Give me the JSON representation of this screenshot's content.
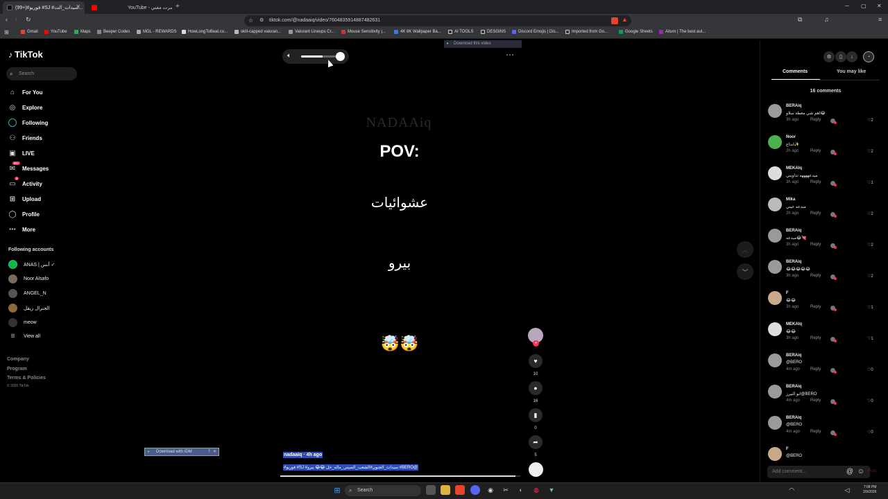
{
  "browser": {
    "tabs": [
      {
        "label": "(99+)#فوريو #SJ #سيدات_الت...",
        "favicon_color": "#000000",
        "active": true
      },
      {
        "label": "YouTube - صرت مغني",
        "favicon_color": "#ff0000",
        "active": false
      }
    ],
    "url": "tiktok.com/@nadaaiq/video/7604835914887482631",
    "bookmarks": [
      "Gmail",
      "YouTube",
      "Maps",
      "Beeper Codes",
      "MGL - REWARDS",
      "HowLongToBeat.co...",
      "skill-capped valoran...",
      "Valorant Lineups Cr...",
      "Mouse Sensitivity |...",
      "4K 8K Wallpaper Ba...",
      "AI TOOLS",
      "DESGINS",
      "Discord Emojis | Dis...",
      "Imported from Go...",
      "Google Sheets",
      "Aitum | The best aut..."
    ]
  },
  "sidebar": {
    "logo": "TikTok",
    "search_placeholder": "Search",
    "nav": [
      {
        "label": "For You",
        "icon": "home-icon"
      },
      {
        "label": "Explore",
        "icon": "compass-icon"
      },
      {
        "label": "Following",
        "icon": "following-icon"
      },
      {
        "label": "Friends",
        "icon": "friends-icon"
      },
      {
        "label": "LIVE",
        "icon": "live-icon"
      },
      {
        "label": "Messages",
        "icon": "messages-icon",
        "badge": "99+"
      },
      {
        "label": "Activity",
        "icon": "activity-icon",
        "badge": "3"
      },
      {
        "label": "Upload",
        "icon": "upload-icon"
      },
      {
        "label": "Profile",
        "icon": "profile-icon"
      },
      {
        "label": "More",
        "icon": "more-icon"
      }
    ],
    "following_title": "Following accounts",
    "following": [
      "ANAS | أنس ✓",
      "Noor Alsafo",
      "ANGEL_N",
      "الجنرال زيقل",
      "meow"
    ],
    "view_all": "View all",
    "footer": [
      "Company",
      "Program",
      "Terms & Policies"
    ],
    "copyright": "© 2026 TikTok"
  },
  "video": {
    "watermark": "NADAAiq",
    "pov": "POV:",
    "line1": "عشوائيات",
    "line2": "بيرو",
    "emoji": "🤯🤯",
    "volume": 0.55,
    "progress": 0.98,
    "download_video": "Download this video",
    "download_idm": "Download with IDM",
    "caption_user": "nadaaiq · 4h ago",
    "caption_tags": "#فوريو #SJ #سيدات_الجنون#الشعب_الصيني_ماله_حل 😂😂 بيرو #BERO@"
  },
  "actions": {
    "likes": "10",
    "comments": "16",
    "saves": "0",
    "shares": "5"
  },
  "panel": {
    "tabs": [
      "Comments",
      "You may like"
    ],
    "count_label": "16 comments",
    "reply_label": "Reply",
    "add_comment_placeholder": "Add comment...",
    "post_label": "Post",
    "comments": [
      {
        "name": "BERAiq",
        "text": "اهم شي معطة سلاو😂",
        "time": "3h ago",
        "likes": "2",
        "avatar_color": "#9a9a9a"
      },
      {
        "name": "Noor",
        "text": "ابداع✨",
        "time": "2h ago",
        "likes": "2",
        "avatar_color": "#4caf50"
      },
      {
        "name": "MEKAIq",
        "text": "مبدعههههه تداويني",
        "time": "3h ago",
        "likes": "1",
        "avatar_color": "#dddddd"
      },
      {
        "name": "Mika",
        "text": "مبدعه عيني",
        "time": "2h ago",
        "likes": "2",
        "avatar_color": "#bbbbbb"
      },
      {
        "name": "BERAiq",
        "text": "مبدعه😂💘",
        "time": "3h ago",
        "likes": "2",
        "avatar_color": "#9a9a9a"
      },
      {
        "name": "BERAiq",
        "text": "😂😂😂😂😂",
        "time": "3h ago",
        "likes": "2",
        "avatar_color": "#9a9a9a"
      },
      {
        "name": "F",
        "text": "😂😂",
        "time": "3h ago",
        "likes": "1",
        "avatar_color": "#c9a98a"
      },
      {
        "name": "MEKAIq",
        "text": "😂😂",
        "time": "3h ago",
        "likes": "1",
        "avatar_color": "#dddddd"
      },
      {
        "name": "BERAiq",
        "text": "@BERO",
        "time": "4m ago",
        "likes": "0",
        "avatar_color": "#9a9a9a"
      },
      {
        "name": "BERAiq",
        "text": "ابو البيرز@BERO",
        "time": "4m ago",
        "likes": "0",
        "avatar_color": "#9a9a9a"
      },
      {
        "name": "BERAiq",
        "text": "@BERO",
        "time": "4m ago",
        "likes": "0",
        "avatar_color": "#9a9a9a"
      },
      {
        "name": "F",
        "text": "@BERO",
        "time": "",
        "likes": "",
        "avatar_color": "#c9a98a"
      }
    ]
  },
  "taskbar": {
    "search_label": "Search",
    "time": "7:08 PM",
    "date": "2/9/2026"
  }
}
